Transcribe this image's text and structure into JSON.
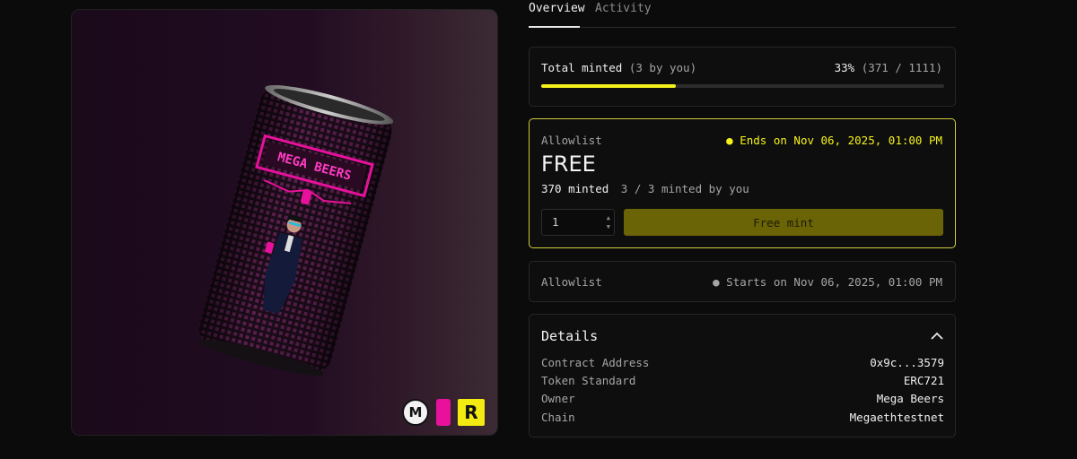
{
  "artwork": {
    "can_text": "MEGA BEERS",
    "badges": {
      "m": "M",
      "r": "R"
    }
  },
  "tabs": [
    {
      "label": "Overview"
    },
    {
      "label": "Activity"
    }
  ],
  "progress": {
    "label": "Total minted",
    "by_you": "(3 by you)",
    "percent_text": "33%",
    "count_text": "(371 / 1111)",
    "fraction": 0.3339
  },
  "active_stage": {
    "name": "Allowlist",
    "ends": "● Ends on Nov 06, 2025, 01:00 PM",
    "price": "FREE",
    "minted": "370 minted",
    "minted_by_you": "3 / 3 minted by you",
    "quantity": "1",
    "mint_button": "Free mint"
  },
  "next_stage": {
    "name": "Allowlist",
    "starts": "● Starts on Nov 06, 2025, 01:00 PM"
  },
  "details": {
    "title": "Details",
    "rows": [
      {
        "key": "Contract Address",
        "value": "0x9c...3579"
      },
      {
        "key": "Token Standard",
        "value": "ERC721"
      },
      {
        "key": "Owner",
        "value": "Mega Beers"
      },
      {
        "key": "Chain",
        "value": "Megaethtestnet"
      }
    ]
  },
  "colors": {
    "accent": "#f4f21a",
    "mint_button": "#6a6406",
    "brand_pink": "#e8119c"
  }
}
